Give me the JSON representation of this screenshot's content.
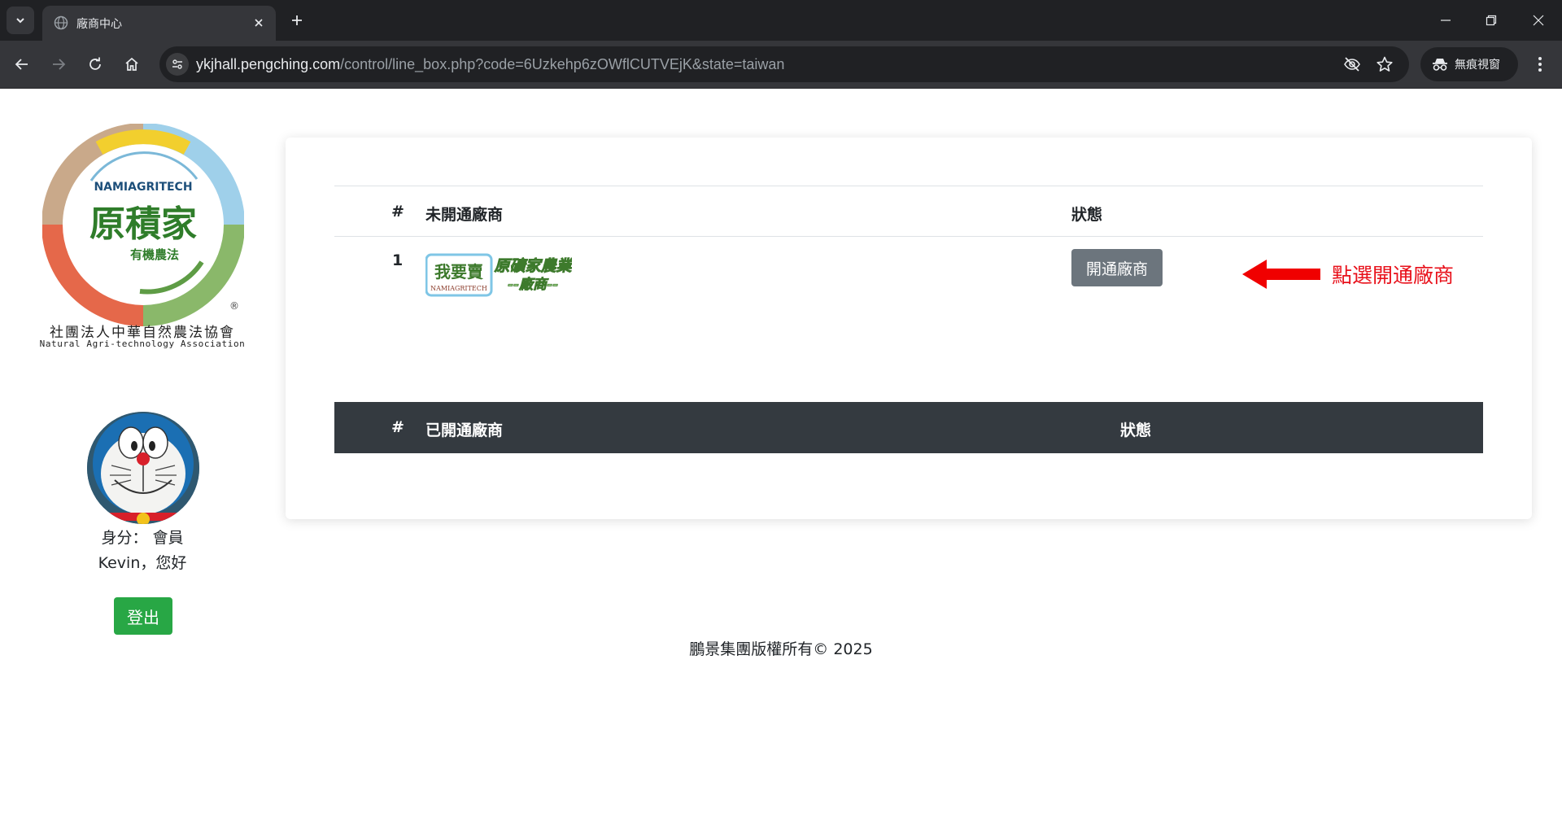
{
  "browser": {
    "tab_title": "廠商中心",
    "url_host": "ykjhall.pengching.com",
    "url_path": "/control/line_box.php?code=6Uzkehp6zOWflCUTVEjK&state=taiwan",
    "incognito_label": "無痕視窗"
  },
  "sidebar": {
    "logo_text_en_top": "NAMIAGRITECH",
    "logo_text_main": "原積家",
    "logo_text_sub": "有機農法",
    "logo_registered": "®",
    "org_name_cn": "社團法人中華自然農法協會",
    "org_name_en": "Natural Agri-technology Association",
    "identity": "身分： 會員",
    "greeting": "Kevin，您好",
    "logout_label": "登出"
  },
  "unopened_table": {
    "headers": [
      "#",
      "未開通廠商",
      "狀態"
    ],
    "rows": [
      {
        "num": "1",
        "vendor_badge": "我要賣",
        "vendor_badge_sub": "NAMIAGRITECH",
        "vendor_name_line1": "原礦家農業",
        "vendor_name_line2": "--廠商--",
        "action_label": "開通廠商"
      }
    ]
  },
  "annotation": {
    "text": "點選開通廠商",
    "color": "#e8101a"
  },
  "opened_table": {
    "headers": [
      "#",
      "已開通廠商",
      "狀態"
    ]
  },
  "footer": {
    "copyright": "鵬景集團版權所有© 2025"
  },
  "colors": {
    "logout": "#28a745",
    "open_button": "#6c757d",
    "dark_header": "#343a40"
  }
}
